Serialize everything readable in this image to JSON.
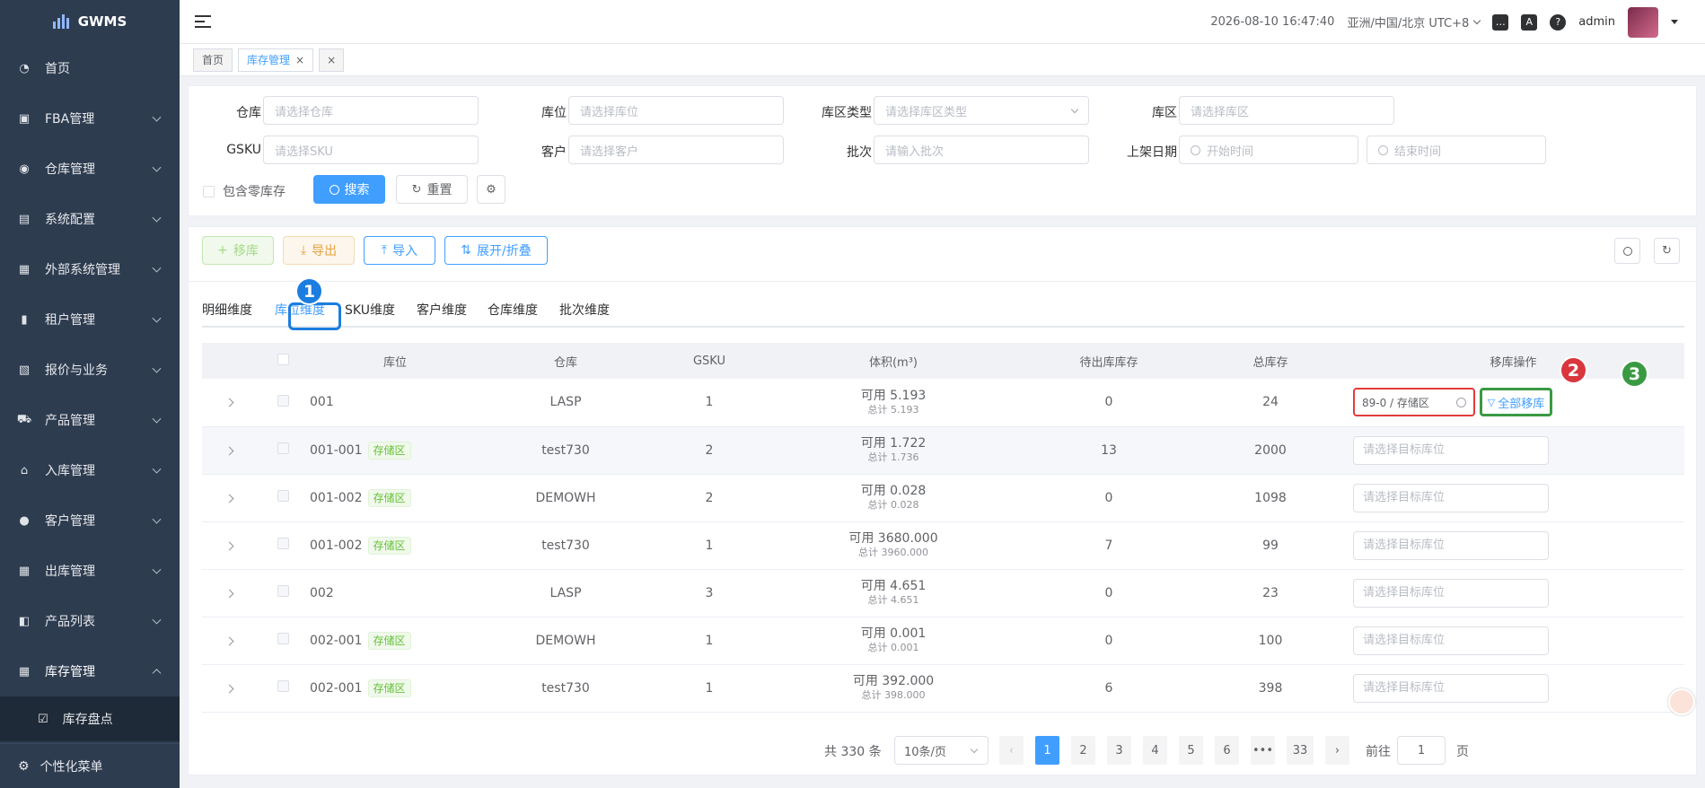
{
  "app": {
    "name": "GWMS"
  },
  "sidebar": {
    "items": [
      {
        "label": "首页",
        "icon": "dashboard-icon"
      },
      {
        "label": "FBA管理",
        "icon": "fba-icon"
      },
      {
        "label": "仓库管理",
        "icon": "warehouse-icon"
      },
      {
        "label": "系统配置",
        "icon": "system-icon"
      },
      {
        "label": "外部系统管理",
        "icon": "grid-icon"
      },
      {
        "label": "租户管理",
        "icon": "bar-chart-icon"
      },
      {
        "label": "报价与业务",
        "icon": "quote-icon"
      },
      {
        "label": "产品管理",
        "icon": "cart-icon"
      },
      {
        "label": "入库管理",
        "icon": "home-icon"
      },
      {
        "label": "客户管理",
        "icon": "user-icon"
      },
      {
        "label": "出库管理",
        "icon": "grid-icon"
      },
      {
        "label": "产品列表",
        "icon": "book-icon"
      },
      {
        "label": "库存管理",
        "icon": "table-icon"
      }
    ],
    "sub_item": "库存盘点",
    "bottom": "个性化菜单"
  },
  "header": {
    "datetime": "2026-08-10 16:47:40",
    "timezone": "亚洲/中国/北京 UTC+8",
    "user": "admin"
  },
  "tags": {
    "home": "首页",
    "active": "库存管理",
    "close_symbol": "×"
  },
  "filter": {
    "warehouse_label": "仓库",
    "warehouse_ph": "请选择仓库",
    "location_label": "库位",
    "location_ph": "请选择库位",
    "zone_type_label": "库区类型",
    "zone_type_ph": "请选择库区类型",
    "zone_label": "库区",
    "zone_ph": "请选择库区",
    "gsku_label": "GSKU",
    "gsku_ph": "请选择SKU",
    "customer_label": "客户",
    "customer_ph": "请选择客户",
    "batch_label": "批次",
    "batch_ph": "请输入批次",
    "shelf_date_label": "上架日期",
    "start_ph": "开始时间",
    "end_ph": "结束时间",
    "zero_stock_label": "包含零库存",
    "search_btn": "搜索",
    "reset_btn": "重置"
  },
  "toolbar": {
    "move": "移库",
    "export": "导出",
    "import": "导入",
    "expand": "展开/折叠"
  },
  "tabs": [
    "明细维度",
    "库位维度",
    "SKU维度",
    "客户维度",
    "仓库维度",
    "批次维度"
  ],
  "active_tab": "库位维度",
  "table": {
    "headers": [
      "库位",
      "仓库",
      "GSKU",
      "体积(m³)",
      "待出库库存",
      "总库存",
      "移库操作"
    ],
    "rows": [
      {
        "location": "001",
        "zone": "",
        "warehouse": "LASP",
        "gsku": "1",
        "avail": "可用 5.193",
        "total_vol": "总计 5.193",
        "pending": "0",
        "stock": "24"
      },
      {
        "location": "001-001",
        "zone": "存储区",
        "warehouse": "test730",
        "gsku": "2",
        "avail": "可用 1.722",
        "total_vol": "总计 1.736",
        "pending": "13",
        "stock": "2000"
      },
      {
        "location": "001-002",
        "zone": "存储区",
        "warehouse": "DEMOWH",
        "gsku": "2",
        "avail": "可用 0.028",
        "total_vol": "总计 0.028",
        "pending": "0",
        "stock": "1098"
      },
      {
        "location": "001-002",
        "zone": "存储区",
        "warehouse": "test730",
        "gsku": "1",
        "avail": "可用 3680.000",
        "total_vol": "总计 3960.000",
        "pending": "7",
        "stock": "99"
      },
      {
        "location": "002",
        "zone": "",
        "warehouse": "LASP",
        "gsku": "3",
        "avail": "可用 4.651",
        "total_vol": "总计 4.651",
        "pending": "0",
        "stock": "23"
      },
      {
        "location": "002-001",
        "zone": "存储区",
        "warehouse": "DEMOWH",
        "gsku": "1",
        "avail": "可用 0.001",
        "total_vol": "总计 0.001",
        "pending": "0",
        "stock": "100"
      },
      {
        "location": "002-001",
        "zone": "存储区",
        "warehouse": "test730",
        "gsku": "1",
        "avail": "可用 392.000",
        "total_vol": "总计 398.000",
        "pending": "6",
        "stock": "398"
      }
    ],
    "target_ph": "请选择目标库位",
    "row1_target_value": "89-0 / 存储区",
    "all_move_btn": "全部移库"
  },
  "badges": [
    "1",
    "2",
    "3"
  ],
  "pagination": {
    "total": "共 330 条",
    "page_size": "10条/页",
    "pages": [
      "1",
      "2",
      "3",
      "4",
      "5",
      "6",
      "•••",
      "33"
    ],
    "current": "1",
    "goto_label": "前往",
    "goto_value": "1",
    "goto_unit": "页"
  }
}
